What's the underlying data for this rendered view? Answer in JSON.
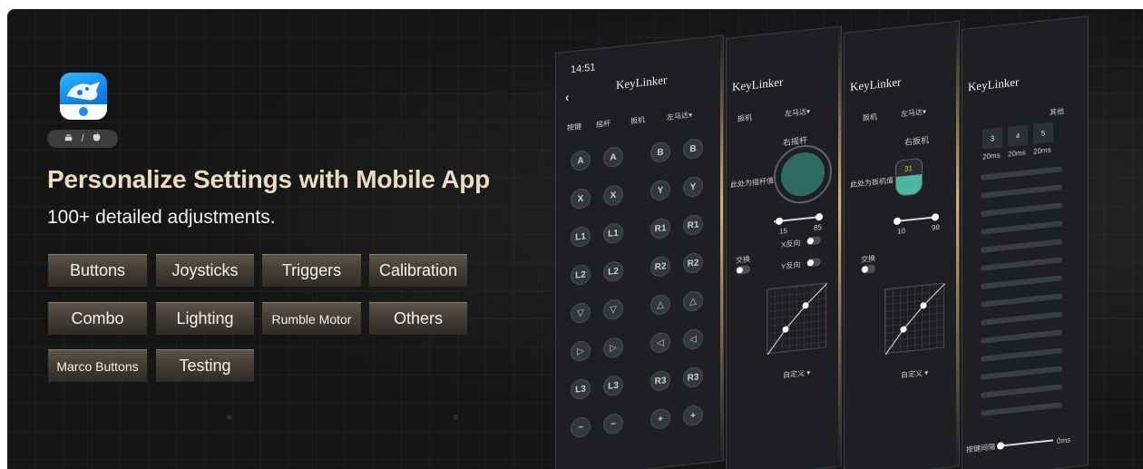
{
  "platform": {
    "android": "android-icon",
    "separator": "/",
    "apple": "apple-icon"
  },
  "headline": "Personalize Settings with Mobile App",
  "subline": "100+ detailed adjustments.",
  "tags": [
    {
      "label": "Buttons"
    },
    {
      "label": "Joysticks"
    },
    {
      "label": "Triggers"
    },
    {
      "label": "Calibration"
    },
    {
      "label": "Combo"
    },
    {
      "label": "Lighting"
    },
    {
      "label": "Rumble Motor"
    },
    {
      "label": "Others"
    },
    {
      "label": "Marco Buttons"
    },
    {
      "label": "Testing"
    }
  ],
  "phones": {
    "time": "14:51",
    "app_name": "KeyLinker",
    "phone1": {
      "tab_labels": [
        "按键",
        "摇杆",
        "扳机",
        "左马达▾"
      ],
      "buttons_left": [
        "A",
        "X",
        "L1",
        "L2",
        "▽",
        "▷",
        "L3",
        "−"
      ],
      "buttons_right": [
        "B",
        "Y",
        "R1",
        "R2",
        "△",
        "◁",
        "R3",
        "+"
      ]
    },
    "phone2": {
      "tab_labels": [
        "扳机",
        "左马达▾"
      ],
      "section": "右摇杆",
      "deadzone": "此处为摇杆值",
      "range_min": "15",
      "range_max": "85",
      "invert_x": "X反向",
      "invert_y": "Y反向",
      "swap": "交换",
      "curve_mode": "自定义 ▾"
    },
    "phone3": {
      "tab_labels": [
        "扳机",
        "左马达▾"
      ],
      "section": "右扳机",
      "trigger_value": "31",
      "deadzone": "此处为扳机值",
      "range_min": "10",
      "range_max": "98",
      "swap": "交换",
      "curve_mode": "自定义 ▾"
    },
    "phone4": {
      "header_label": "其他",
      "macro_cells": [
        "3",
        "4",
        "5"
      ],
      "macro_times": [
        "20ms",
        "20ms",
        "20ms"
      ],
      "slider_label": "按键间隔",
      "slider_value": "0ms"
    }
  },
  "colors": {
    "accent": "#efdcbf",
    "stick": "#2e6a60",
    "app_icon": "#1d8ff0"
  }
}
